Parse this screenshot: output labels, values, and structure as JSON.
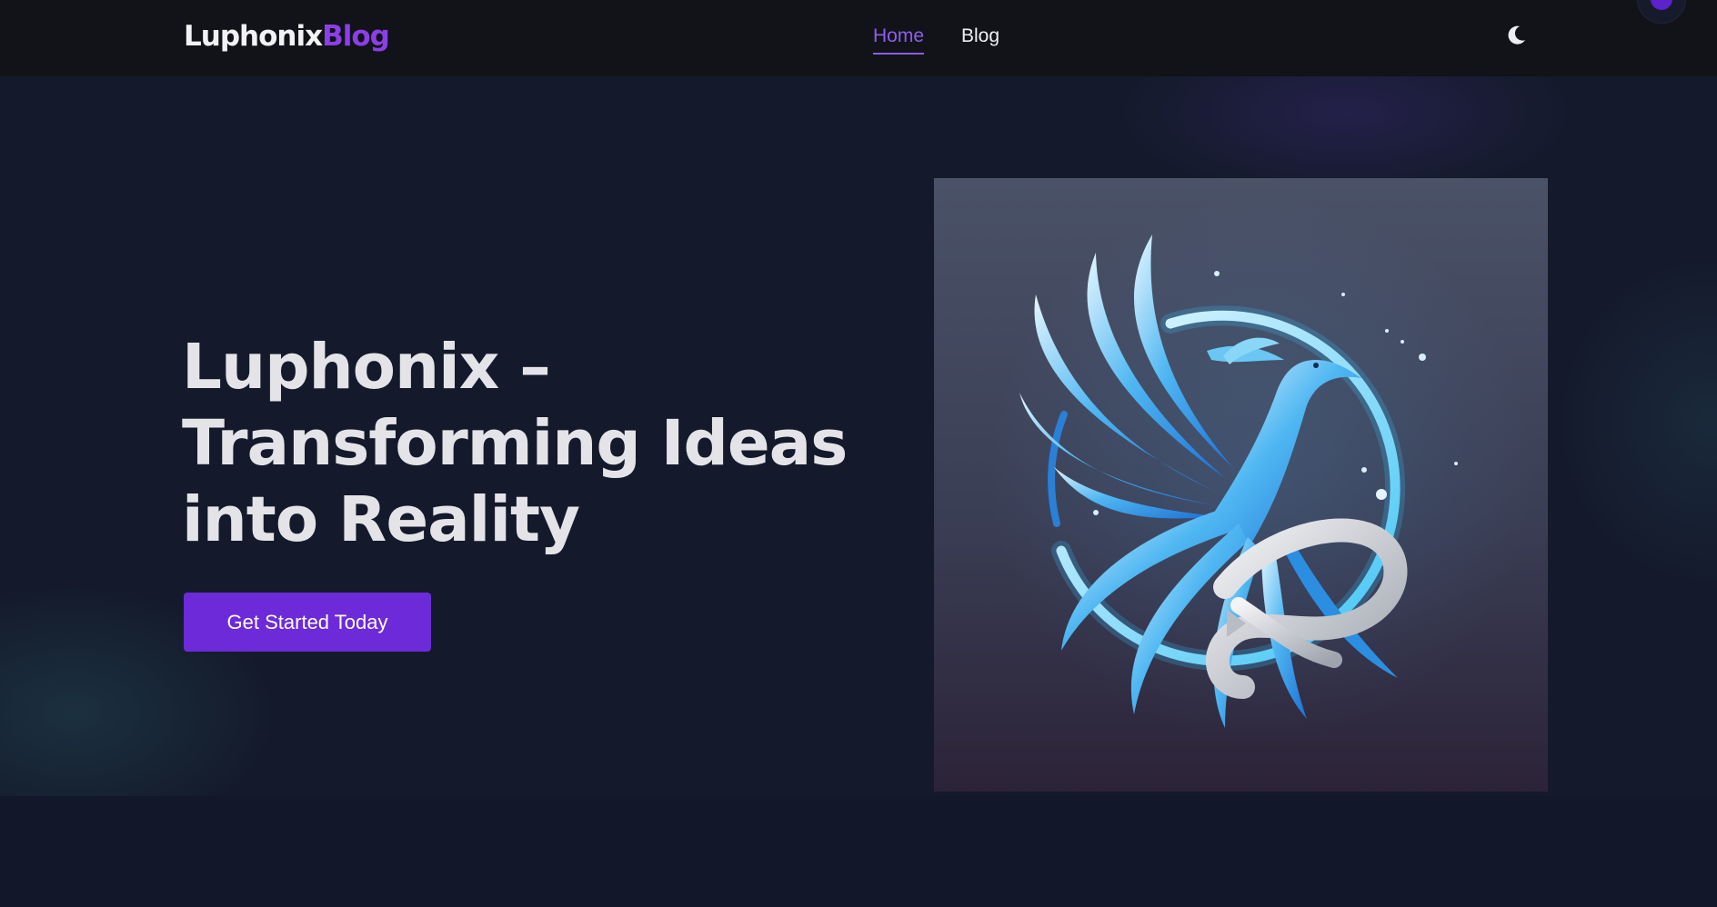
{
  "brand": {
    "part1": "Luphonix",
    "part2": "Blog"
  },
  "nav": {
    "items": [
      {
        "label": "Home",
        "active": true
      },
      {
        "label": "Blog",
        "active": false
      }
    ]
  },
  "theme_toggle": {
    "icon": "moon-icon"
  },
  "hero": {
    "title": "Luphonix – Transforming Ideas into Reality",
    "cta_label": "Get Started Today",
    "image": {
      "icon": "phoenix-infinity-logo"
    }
  },
  "colors": {
    "accent": "#6d2ad8",
    "nav_active": "#8f5cf2",
    "brand_highlight": "#8b3fe6",
    "header_bg": "#111318",
    "page_bg": "#141a2b"
  }
}
